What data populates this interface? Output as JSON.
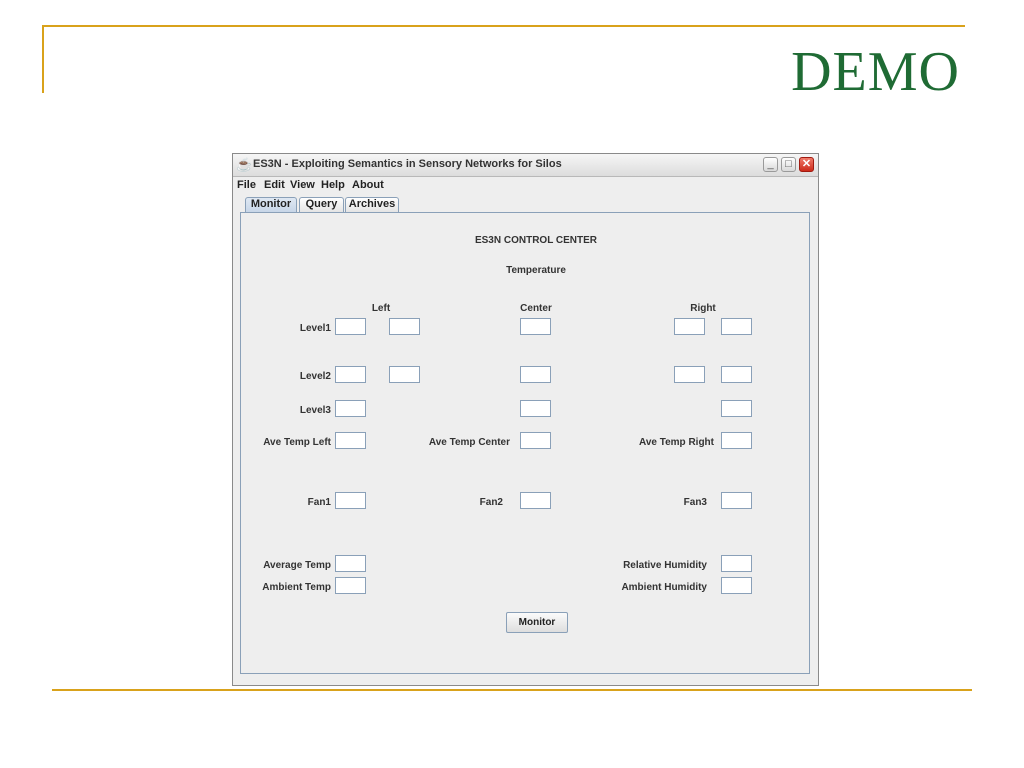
{
  "slide": {
    "title": "DEMO"
  },
  "window": {
    "title": "ES3N - Exploiting Semantics in Sensory Networks for Silos",
    "icon": "java-icon",
    "controls": {
      "minimize": "_",
      "maximize": "□",
      "close": "✕"
    }
  },
  "menu": {
    "file": "File",
    "edit": "Edit",
    "view": "View",
    "help": "Help",
    "about": "About"
  },
  "tabs": [
    "Monitor",
    "Query",
    "Archives"
  ],
  "active_tab": "Monitor",
  "panel": {
    "heading": "ES3N CONTROL CENTER",
    "subheading": "Temperature",
    "columns": {
      "left": "Left",
      "center": "Center",
      "right": "Right"
    },
    "rows": {
      "level1": "Level1",
      "level2": "Level2",
      "level3": "Level3",
      "ave_left": "Ave Temp Left",
      "ave_center": "Ave Temp Center",
      "ave_right": "Ave Temp Right",
      "fan1": "Fan1",
      "fan2": "Fan2",
      "fan3": "Fan3",
      "average_temp": "Average Temp",
      "ambient_temp": "Ambient Temp",
      "relative_humidity": "Relative Humidity",
      "ambient_humidity": "Ambient Humidity"
    },
    "fields": {
      "level1_left_a": "",
      "level1_left_b": "",
      "level1_center": "",
      "level1_right_a": "",
      "level1_right_b": "",
      "level2_left_a": "",
      "level2_left_b": "",
      "level2_center": "",
      "level2_right_a": "",
      "level2_right_b": "",
      "level3_left": "",
      "level3_center": "",
      "level3_right": "",
      "ave_left": "",
      "ave_center": "",
      "ave_right": "",
      "fan1": "",
      "fan2": "",
      "fan3": "",
      "average_temp": "",
      "ambient_temp": "",
      "relative_humidity": "",
      "ambient_humidity": ""
    },
    "monitor_button": "Monitor"
  },
  "colors": {
    "slide_accent": "#d9a21b",
    "slide_title": "#1f6b34",
    "field_border": "#8aa0b8"
  }
}
